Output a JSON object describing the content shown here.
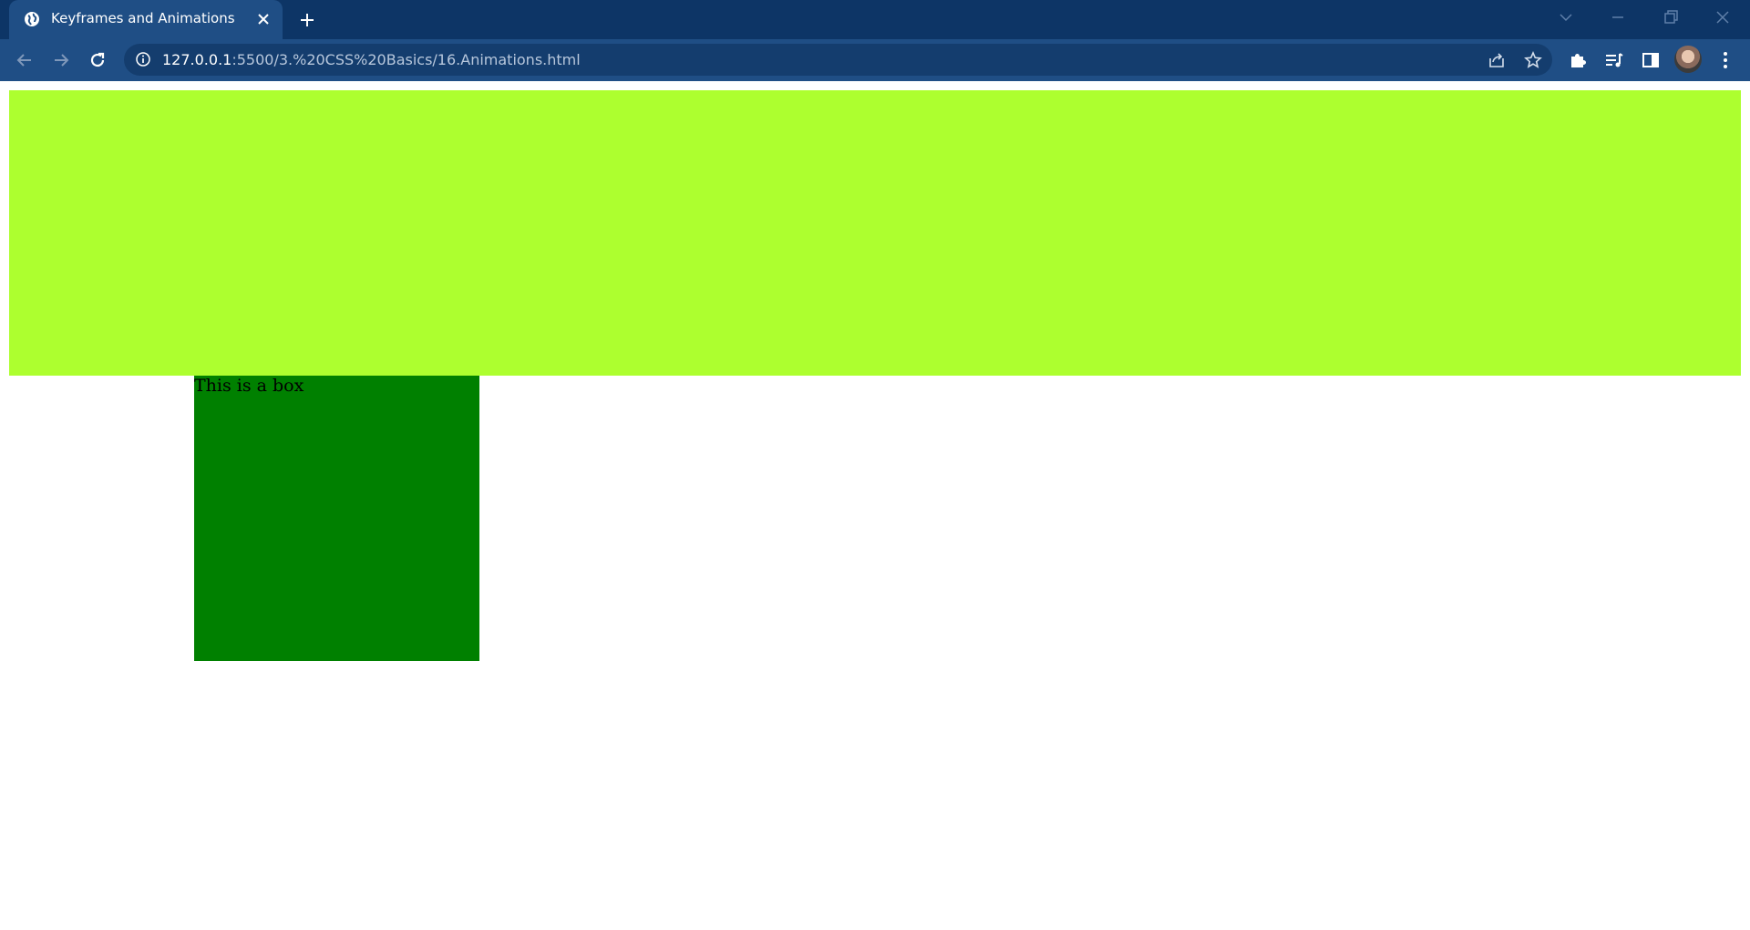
{
  "browser": {
    "tab": {
      "title": "Keyframes and Animations",
      "favicon": "globe-icon",
      "close_icon": "close-icon"
    },
    "new_tab_icon": "plus-icon",
    "window_controls": [
      "tab-search-icon",
      "minimize-icon",
      "restore-icon",
      "close-icon"
    ],
    "toolbar": {
      "back_icon": "arrow-left-icon",
      "forward_icon": "arrow-right-icon",
      "reload_icon": "reload-icon",
      "address": {
        "info_icon": "info-icon",
        "host": "127.0.0.1",
        "path": ":5500/3.%20CSS%20Basics/16.Animations.html",
        "share_icon": "share-icon",
        "bookmark_icon": "star-icon"
      },
      "extensions_icon": "puzzle-icon",
      "media_icon": "media-list-icon",
      "side_panel_icon": "side-panel-icon",
      "profile_icon": "avatar",
      "menu_icon": "kebab-menu-icon"
    },
    "colors": {
      "tabstrip": "#0d3566",
      "toolbar": "#1f4e85",
      "omnibox": "#143d6e"
    }
  },
  "page": {
    "banner_color": "#adff2f",
    "box": {
      "text": "This is a box",
      "color": "#008000"
    }
  }
}
